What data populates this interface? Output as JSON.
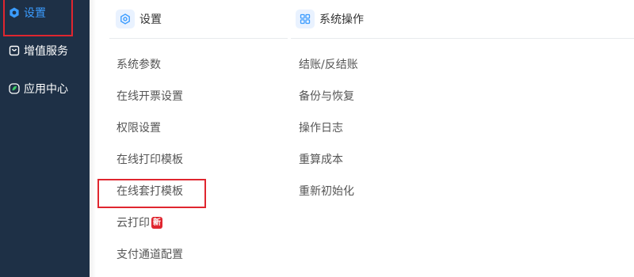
{
  "sidebar": {
    "items": [
      {
        "label": "设置",
        "icon": "settings-hex-icon"
      },
      {
        "label": "增值服务",
        "icon": "shopping-bag-icon"
      },
      {
        "label": "应用中心",
        "icon": "app-leaf-icon"
      }
    ]
  },
  "settings_column": {
    "title": "设置",
    "icon": "settings-hex-icon",
    "items": [
      {
        "label": "系统参数"
      },
      {
        "label": "在线开票设置"
      },
      {
        "label": "权限设置"
      },
      {
        "label": "在线打印模板"
      },
      {
        "label": "在线套打模板"
      },
      {
        "label": "云打印",
        "badge": "新"
      },
      {
        "label": "支付通道配置"
      }
    ]
  },
  "operations_column": {
    "title": "系统操作",
    "icon": "grid-four-icon",
    "items": [
      {
        "label": "结账/反结账"
      },
      {
        "label": "备份与恢复"
      },
      {
        "label": "操作日志"
      },
      {
        "label": "重算成本"
      },
      {
        "label": "重新初始化"
      }
    ]
  },
  "colors": {
    "sidebar_bg": "#1e3046",
    "accent": "#3b9cff",
    "highlight_border": "#e0262f",
    "badge_bg": "#e0262f"
  }
}
